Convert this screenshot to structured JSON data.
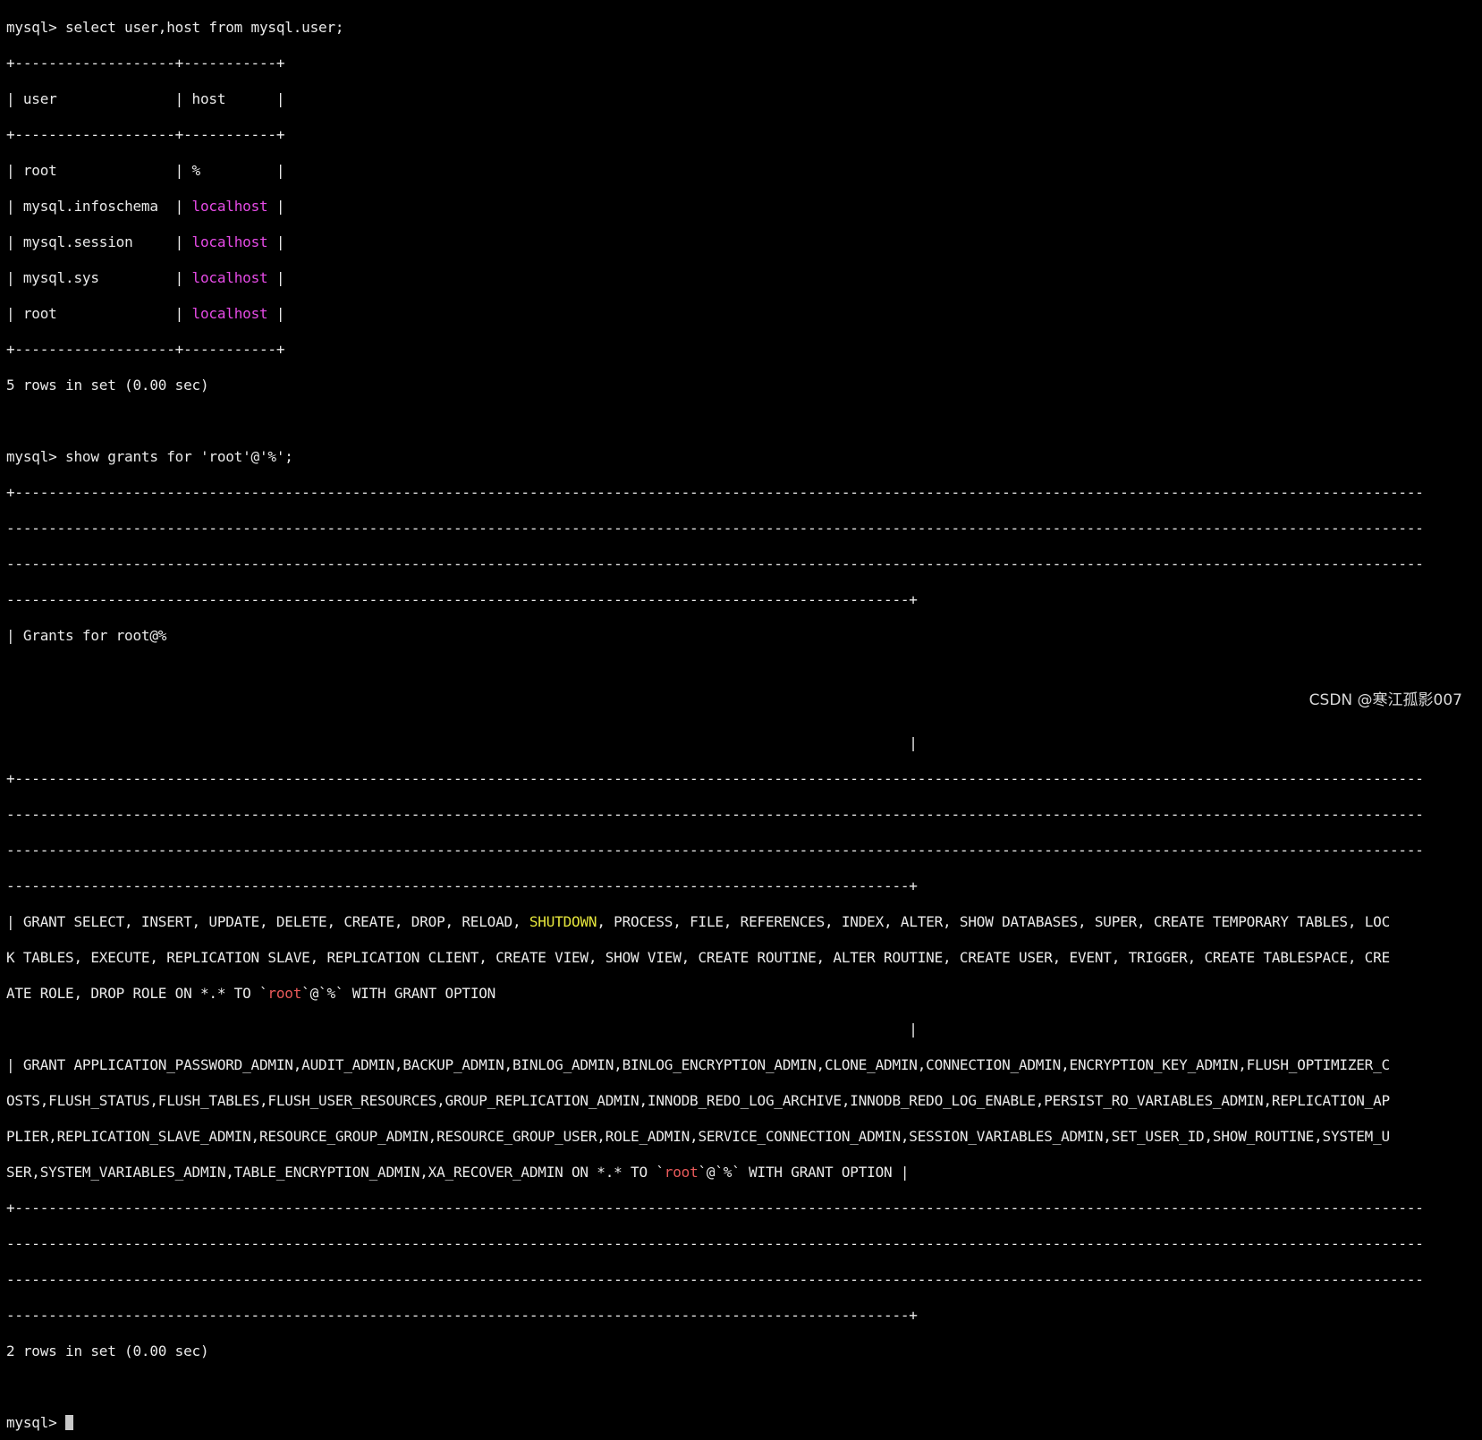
{
  "commands": {
    "cmd1": "mysql> select user,host from mysql.user;",
    "cmd2": "mysql> show grants for 'root'@'%';",
    "prompt": "mysql> "
  },
  "users_table": {
    "border": "+-------------------+-----------+",
    "header_user": "user",
    "header_host": "host",
    "rows": [
      {
        "user": "root",
        "host": "%"
      },
      {
        "user": "mysql.infoschema",
        "host": "localhost"
      },
      {
        "user": "mysql.session",
        "host": "localhost"
      },
      {
        "user": "mysql.sys",
        "host": "localhost"
      },
      {
        "user": "root",
        "host": "localhost"
      }
    ],
    "footer": "5 rows in set (0.00 sec)"
  },
  "grants_table": {
    "border_top": "+-----------------------------------------------------------------------------------------------------------------------------------------------------------------------",
    "border_mid": "------------------------------------------------------------------------------------------------------------------------------------------------------------------------",
    "border_end": "-----------------------------------------------------------------------------------------------------------+",
    "header": "| Grants for root@%",
    "pipe_line": "                                                                                                           |",
    "grant1_a": "| GRANT SELECT, INSERT, UPDATE, DELETE, CREATE, DROP, RELOAD, ",
    "grant1_kw": "SHUTDOWN",
    "grant1_b": ", PROCESS, FILE, REFERENCES, INDEX, ALTER, SHOW DATABASES, SUPER, CREATE TEMPORARY TABLES, LOC",
    "grant1_line2": "K TABLES, EXECUTE, REPLICATION SLAVE, REPLICATION CLIENT, CREATE VIEW, SHOW VIEW, CREATE ROUTINE, ALTER ROUTINE, CREATE USER, EVENT, TRIGGER, CREATE TABLESPACE, CRE",
    "grant1_line3_a": "ATE ROLE, DROP ROLE ON *.* TO `",
    "grant_root": "root",
    "grant1_line3_b": "`@`%` WITH GRANT OPTION",
    "grant2_line1": "| GRANT APPLICATION_PASSWORD_ADMIN,AUDIT_ADMIN,BACKUP_ADMIN,BINLOG_ADMIN,BINLOG_ENCRYPTION_ADMIN,CLONE_ADMIN,CONNECTION_ADMIN,ENCRYPTION_KEY_ADMIN,FLUSH_OPTIMIZER_C",
    "grant2_line2": "OSTS,FLUSH_STATUS,FLUSH_TABLES,FLUSH_USER_RESOURCES,GROUP_REPLICATION_ADMIN,INNODB_REDO_LOG_ARCHIVE,INNODB_REDO_LOG_ENABLE,PERSIST_RO_VARIABLES_ADMIN,REPLICATION_AP",
    "grant2_line3": "PLIER,REPLICATION_SLAVE_ADMIN,RESOURCE_GROUP_ADMIN,RESOURCE_GROUP_USER,ROLE_ADMIN,SERVICE_CONNECTION_ADMIN,SESSION_VARIABLES_ADMIN,SET_USER_ID,SHOW_ROUTINE,SYSTEM_U",
    "grant2_line4_a": "SER,SYSTEM_VARIABLES_ADMIN,TABLE_ENCRYPTION_ADMIN,XA_RECOVER_ADMIN ON *.* TO `",
    "grant2_line4_b": "`@`%` WITH GRANT OPTION |",
    "footer": "2 rows in set (0.00 sec)"
  },
  "watermark": "CSDN @寒江孤影007"
}
